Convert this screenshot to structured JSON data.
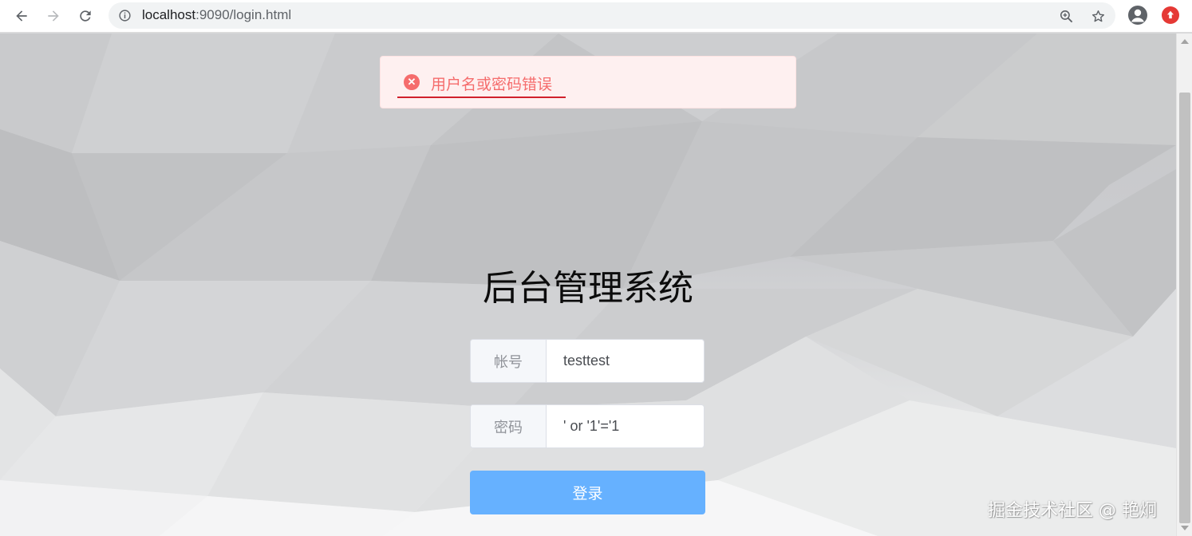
{
  "browser": {
    "url_host": "localhost",
    "url_path": ":9090/login.html",
    "icons": {
      "back": "arrow-left-icon",
      "forward": "arrow-right-icon",
      "reload": "reload-icon",
      "site_info": "info-icon",
      "zoom": "zoom-icon",
      "bookmark": "star-icon",
      "profile": "avatar-icon",
      "extension": "extension-icon"
    }
  },
  "alert": {
    "message": "用户名或密码错误",
    "color": "#f56c6c"
  },
  "login": {
    "title": "后台管理系统",
    "username_label": "帐号",
    "username_value": "testtest",
    "password_label": "密码",
    "password_value": "' or '1'='1",
    "submit_label": "登录",
    "button_color": "#66b1ff"
  },
  "watermark": "掘金技术社区 @ 艳炯"
}
